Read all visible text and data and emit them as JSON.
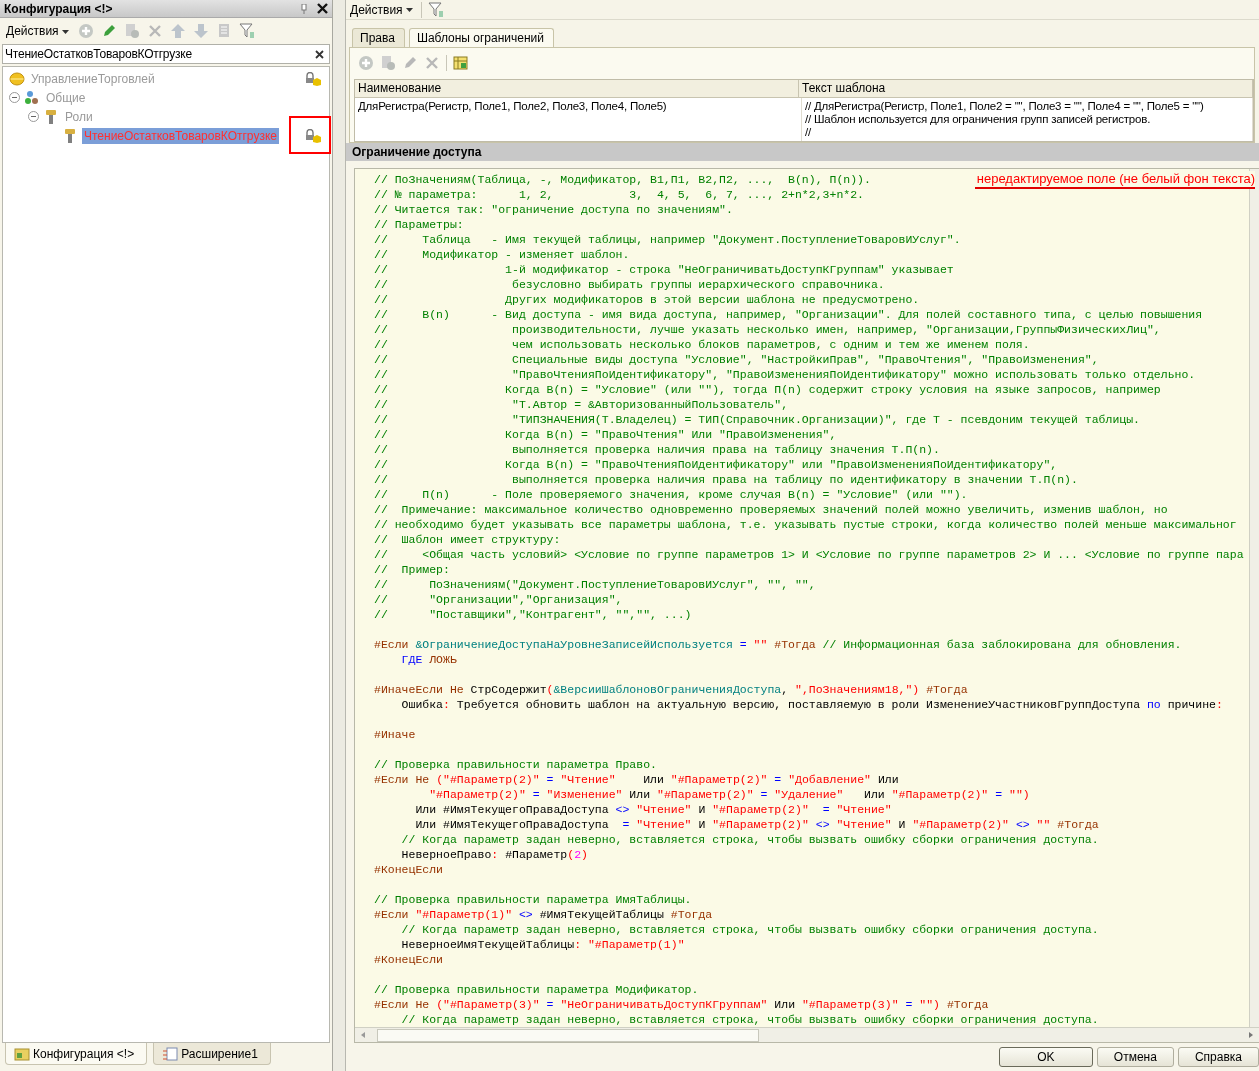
{
  "config_panel": {
    "title": "Конфигурация <!>",
    "actions_menu": "Действия",
    "search": {
      "value": "ЧтениеОстатковТоваровКОтгрузке"
    },
    "tree": [
      {
        "label": "УправлениеТорговлей",
        "kind": "configuration",
        "locked": true,
        "selected": false
      },
      {
        "label": "Общие",
        "kind": "group",
        "expanded": true,
        "locked": false,
        "selected": false,
        "children": [
          {
            "label": "Роли",
            "kind": "roles",
            "expanded": true,
            "locked": false,
            "selected": false,
            "children": [
              {
                "label": "ЧтениеОстатковТоваровКОтгрузке",
                "kind": "role",
                "locked": true,
                "selected": true,
                "annotated": true
              }
            ]
          }
        ]
      }
    ],
    "bottom_tabs": [
      {
        "label": "Конфигурация <!>",
        "kind": "configuration",
        "selected": true
      },
      {
        "label": "Расширение1",
        "kind": "extension",
        "selected": false
      }
    ]
  },
  "roles_panel": {
    "actions_menu": "Действия",
    "tabs": [
      {
        "label": "Права",
        "selected": false
      },
      {
        "label": "Шаблоны ограничений",
        "selected": true
      }
    ],
    "table": {
      "columns": [
        "Наименование",
        "Текст шаблона"
      ],
      "rows": [
        {
          "cells": [
            {
              "lines": [
                "ДляРегистра(Регистр, Поле1, Поле2, Поле3, Поле4, Поле5)"
              ]
            },
            {
              "lines": [
                "// ДляРегистра(Регистр, Поле1, Поле2 = \"\", Поле3 = \"\", Поле4 = \"\", Поле5 = \"\")",
                "// Шаблон используется для ограничения групп записей регистров.",
                "//"
              ]
            }
          ]
        }
      ]
    }
  },
  "dialog": {
    "title": "Ограничение доступа",
    "annotation": "нередактируемое поле (не белый фон текста)",
    "code_lines": [
      {
        "tokens": [
          {
            "kind": "comment",
            "text": "// ПоЗначениям(Таблица, -, Модификатор, В1,П1, В2,П2, ...,  В(n), П(n))."
          }
        ]
      },
      {
        "tokens": [
          {
            "kind": "comment",
            "text": "// № параметра:      1, 2,           3,  4, 5,  6, 7, ..., 2+n*2,3+n*2."
          }
        ]
      },
      {
        "tokens": [
          {
            "kind": "comment",
            "text": "// Читается так: \"ограничение доступа по значениям\"."
          }
        ]
      },
      {
        "tokens": [
          {
            "kind": "comment",
            "text": "// Параметры:"
          }
        ]
      },
      {
        "tokens": [
          {
            "kind": "comment",
            "text": "//     Таблица   - Имя текущей таблицы, например \"Документ.ПоступлениеТоваровИУслуг\"."
          }
        ]
      },
      {
        "tokens": [
          {
            "kind": "comment",
            "text": "//     Модификатор - изменяет шаблон."
          }
        ]
      },
      {
        "tokens": [
          {
            "kind": "comment",
            "text": "//                 1-й модификатор - строка \"НеОграничиватьДоступКГруппам\" указывает"
          }
        ]
      },
      {
        "tokens": [
          {
            "kind": "comment",
            "text": "//                  безусловно выбирать группы иерархического справочника."
          }
        ]
      },
      {
        "tokens": [
          {
            "kind": "comment",
            "text": "//                 Других модификаторов в этой версии шаблона не предусмотрено."
          }
        ]
      },
      {
        "tokens": [
          {
            "kind": "comment",
            "text": "//     В(n)      - Вид доступа - имя вида доступа, например, \"Организации\". Для полей составного типа, с целью повышения"
          }
        ]
      },
      {
        "tokens": [
          {
            "kind": "comment",
            "text": "//                  производительности, лучше указать несколько имен, например, \"Организации,ГруппыФизическихЛиц\","
          }
        ]
      },
      {
        "tokens": [
          {
            "kind": "comment",
            "text": "//                  чем использовать несколько блоков параметров, с одним и тем же именем поля."
          }
        ]
      },
      {
        "tokens": [
          {
            "kind": "comment",
            "text": "//                  Специальные виды доступа \"Условие\", \"НастройкиПрав\", \"ПравоЧтения\", \"ПравоИзменения\","
          }
        ]
      },
      {
        "tokens": [
          {
            "kind": "comment",
            "text": "//                  \"ПравоЧтенияПоИдентификатору\", \"ПравоИзмененияПоИдентификатору\" можно использовать только отдельно."
          }
        ]
      },
      {
        "tokens": [
          {
            "kind": "comment",
            "text": "//                 Когда В(n) = \"Условие\" (или \"\"), тогда П(n) содержит строку условия на языке запросов, например"
          }
        ]
      },
      {
        "tokens": [
          {
            "kind": "comment",
            "text": "//                  \"Т.Автор = &АвторизованныйПользователь\","
          }
        ]
      },
      {
        "tokens": [
          {
            "kind": "comment",
            "text": "//                  \"ТИПЗНАЧЕНИЯ(Т.Владелец) = ТИП(Справочник.Организации)\", где Т - псевдоним текущей таблицы."
          }
        ]
      },
      {
        "tokens": [
          {
            "kind": "comment",
            "text": "//                 Когда В(n) = \"ПравоЧтения\" Или \"ПравоИзменения\","
          }
        ]
      },
      {
        "tokens": [
          {
            "kind": "comment",
            "text": "//                  выполняется проверка наличия права на таблицу значения Т.П(n)."
          }
        ]
      },
      {
        "tokens": [
          {
            "kind": "comment",
            "text": "//                 Когда В(n) = \"ПравоЧтенияПоИдентификатору\" или \"ПравоИзмененияПоИдентификатору\","
          }
        ]
      },
      {
        "tokens": [
          {
            "kind": "comment",
            "text": "//                  выполняется проверка наличия права на таблицу по идентификатору в значении Т.П(n)."
          }
        ]
      },
      {
        "tokens": [
          {
            "kind": "comment",
            "text": "//     П(n)      - Поле проверяемого значения, кроме случая В(n) = \"Условие\" (или \"\")."
          }
        ]
      },
      {
        "tokens": [
          {
            "kind": "comment",
            "text": "//  Примечание: максимальное количество одновременно проверяемых значений полей можно увеличить, изменив шаблон, но"
          }
        ]
      },
      {
        "tokens": [
          {
            "kind": "comment",
            "text": "// необходимо будет указывать все параметры шаблона, т.е. указывать пустые строки, когда количество полей меньше максимальног"
          }
        ]
      },
      {
        "tokens": [
          {
            "kind": "comment",
            "text": "//  Шаблон имеет структуру:"
          }
        ]
      },
      {
        "tokens": [
          {
            "kind": "comment",
            "text": "//     <Общая часть условий> <Условие по группе параметров 1> И <Условие по группе параметров 2> И ... <Условие по группе пара"
          }
        ]
      },
      {
        "tokens": [
          {
            "kind": "comment",
            "text": "//  Пример:"
          }
        ]
      },
      {
        "tokens": [
          {
            "kind": "comment",
            "text": "//      ПоЗначениям(\"Документ.ПоступлениеТоваровИУслуг\", \"\", \"\","
          }
        ]
      },
      {
        "tokens": [
          {
            "kind": "comment",
            "text": "//      \"Организации\",\"Организация\","
          }
        ]
      },
      {
        "tokens": [
          {
            "kind": "comment",
            "text": "//      \"Поставщики\",\"Контрагент\", \"\",\"\", ...)"
          }
        ]
      },
      {
        "blank_before": true,
        "tokens": [
          {
            "kind": "pre",
            "text": "#Если "
          },
          {
            "kind": "ref",
            "text": "&ОграничениеДоступаНаУровнеЗаписейИспользуется"
          },
          {
            "kind": "op",
            "text": " = "
          },
          {
            "kind": "str",
            "text": "\"\""
          },
          {
            "kind": "pre",
            "text": " #Тогда"
          },
          {
            "kind": "comment",
            "text": " // Информационная база заблокирована для обновления."
          }
        ]
      },
      {
        "tokens": [
          {
            "kind": "kw",
            "text": "    ГДЕ "
          },
          {
            "kind": "pre",
            "text": "ЛОЖЬ"
          }
        ]
      },
      {
        "blank_before": true,
        "tokens": [
          {
            "kind": "pre",
            "text": "#ИначеЕсли Не"
          },
          {
            "kind": "text",
            "text": " СтрСодержит"
          },
          {
            "kind": "punct",
            "text": "("
          },
          {
            "kind": "ref",
            "text": "&ВерсииШаблоновОграниченияДоступа"
          },
          {
            "kind": "text",
            "text": ", "
          },
          {
            "kind": "str",
            "text": "\",ПоЗначениям18,\""
          },
          {
            "kind": "punct",
            "text": ")"
          },
          {
            "kind": "pre",
            "text": " #Тогда"
          }
        ]
      },
      {
        "tokens": [
          {
            "kind": "text",
            "text": "    Ошибка"
          },
          {
            "kind": "punct",
            "text": ":"
          },
          {
            "kind": "text",
            "text": " Требуется обновить шаблон на актуальную версию, поставляемую в роли ИзменениеУчастниковГруппДоступа "
          },
          {
            "kind": "kw",
            "text": "по"
          },
          {
            "kind": "text",
            "text": " причине"
          },
          {
            "kind": "punct",
            "text": ":"
          }
        ]
      },
      {
        "blank_before": true,
        "tokens": [
          {
            "kind": "pre",
            "text": "#Иначе"
          }
        ]
      },
      {
        "blank_before": true,
        "tokens": [
          {
            "kind": "comment",
            "text": "// Проверка правильности параметра Право."
          }
        ]
      },
      {
        "tokens": [
          {
            "kind": "pre",
            "text": "#Если Не "
          },
          {
            "kind": "punct",
            "text": "("
          },
          {
            "kind": "str",
            "text": "\"#Параметр(2)\""
          },
          {
            "kind": "op",
            "text": " = "
          },
          {
            "kind": "str",
            "text": "\"Чтение\""
          },
          {
            "kind": "text",
            "text": "    Или "
          },
          {
            "kind": "str",
            "text": "\"#Параметр(2)\""
          },
          {
            "kind": "op",
            "text": " = "
          },
          {
            "kind": "str",
            "text": "\"Добавление\""
          },
          {
            "kind": "text",
            "text": " Или"
          }
        ]
      },
      {
        "tokens": [
          {
            "kind": "str",
            "text": "        \"#Параметр(2)\""
          },
          {
            "kind": "op",
            "text": " = "
          },
          {
            "kind": "str",
            "text": "\"Изменение\""
          },
          {
            "kind": "text",
            "text": " Или "
          },
          {
            "kind": "str",
            "text": "\"#Параметр(2)\""
          },
          {
            "kind": "op",
            "text": " = "
          },
          {
            "kind": "str",
            "text": "\"Удаление\""
          },
          {
            "kind": "text",
            "text": "   Или "
          },
          {
            "kind": "str",
            "text": "\"#Параметр(2)\""
          },
          {
            "kind": "op",
            "text": " = "
          },
          {
            "kind": "str",
            "text": "\"\""
          },
          {
            "kind": "punct",
            "text": ")"
          }
        ]
      },
      {
        "tokens": [
          {
            "kind": "text",
            "text": "      Или #ИмяТекущегоПраваДоступа "
          },
          {
            "kind": "op",
            "text": "<> "
          },
          {
            "kind": "str",
            "text": "\"Чтение\""
          },
          {
            "kind": "text",
            "text": " И "
          },
          {
            "kind": "str",
            "text": "\"#Параметр(2)\""
          },
          {
            "kind": "op",
            "text": "  = "
          },
          {
            "kind": "str",
            "text": "\"Чтение\""
          }
        ]
      },
      {
        "tokens": [
          {
            "kind": "text",
            "text": "      Или #ИмяТекущегоПраваДоступа  "
          },
          {
            "kind": "op",
            "text": "= "
          },
          {
            "kind": "str",
            "text": "\"Чтение\""
          },
          {
            "kind": "text",
            "text": " И "
          },
          {
            "kind": "str",
            "text": "\"#Параметр(2)\""
          },
          {
            "kind": "op",
            "text": " <> "
          },
          {
            "kind": "str",
            "text": "\"Чтение\""
          },
          {
            "kind": "text",
            "text": " И "
          },
          {
            "kind": "str",
            "text": "\"#Параметр(2)\""
          },
          {
            "kind": "op",
            "text": " <> "
          },
          {
            "kind": "str",
            "text": "\"\""
          },
          {
            "kind": "pre",
            "text": " #Тогда"
          }
        ]
      },
      {
        "tokens": [
          {
            "kind": "comment",
            "text": "    // Когда параметр задан неверно, вставляется строка, чтобы вызвать ошибку сборки ограничения доступа."
          }
        ]
      },
      {
        "tokens": [
          {
            "kind": "text",
            "text": "    НеверноеПраво"
          },
          {
            "kind": "punct",
            "text": ":"
          },
          {
            "kind": "text",
            "text": " #Параметр"
          },
          {
            "kind": "punct",
            "text": "("
          },
          {
            "kind": "num",
            "text": "2"
          },
          {
            "kind": "punct",
            "text": ")"
          }
        ]
      },
      {
        "tokens": [
          {
            "kind": "pre",
            "text": "#КонецЕсли"
          }
        ]
      },
      {
        "blank_before": true,
        "tokens": [
          {
            "kind": "comment",
            "text": "// Проверка правильности параметра ИмяТаблицы."
          }
        ]
      },
      {
        "tokens": [
          {
            "kind": "pre",
            "text": "#Если "
          },
          {
            "kind": "str",
            "text": "\"#Параметр(1)\""
          },
          {
            "kind": "op",
            "text": " <> "
          },
          {
            "kind": "text",
            "text": "#ИмяТекущейТаблицы"
          },
          {
            "kind": "pre",
            "text": " #Тогда"
          }
        ]
      },
      {
        "tokens": [
          {
            "kind": "comment",
            "text": "    // Когда параметр задан неверно, вставляется строка, чтобы вызвать ошибку сборки ограничения доступа."
          }
        ]
      },
      {
        "tokens": [
          {
            "kind": "text",
            "text": "    НеверноеИмяТекущейТаблицы"
          },
          {
            "kind": "punct",
            "text": ": "
          },
          {
            "kind": "str",
            "text": "\"#Параметр(1)\""
          }
        ]
      },
      {
        "tokens": [
          {
            "kind": "pre",
            "text": "#КонецЕсли"
          }
        ]
      },
      {
        "blank_before": true,
        "tokens": [
          {
            "kind": "comment",
            "text": "// Проверка правильности параметра Модификатор."
          }
        ]
      },
      {
        "tokens": [
          {
            "kind": "pre",
            "text": "#Если Не "
          },
          {
            "kind": "punct",
            "text": "("
          },
          {
            "kind": "str",
            "text": "\"#Параметр(3)\""
          },
          {
            "kind": "op",
            "text": " = "
          },
          {
            "kind": "str",
            "text": "\"НеОграничиватьДоступКГруппам\""
          },
          {
            "kind": "text",
            "text": " Или "
          },
          {
            "kind": "str",
            "text": "\"#Параметр(3)\""
          },
          {
            "kind": "op",
            "text": " = "
          },
          {
            "kind": "str",
            "text": "\"\""
          },
          {
            "kind": "punct",
            "text": ")"
          },
          {
            "kind": "pre",
            "text": " #Тогда"
          }
        ]
      },
      {
        "tokens": [
          {
            "kind": "comment",
            "text": "    // Когда параметр задан неверно, вставляется строка, чтобы вызвать ошибку сборки ограничения доступа."
          }
        ]
      }
    ],
    "buttons": [
      {
        "label": "OK",
        "default": true
      },
      {
        "label": "Отмена",
        "default": false
      },
      {
        "label": "Справка",
        "default": false
      }
    ]
  }
}
